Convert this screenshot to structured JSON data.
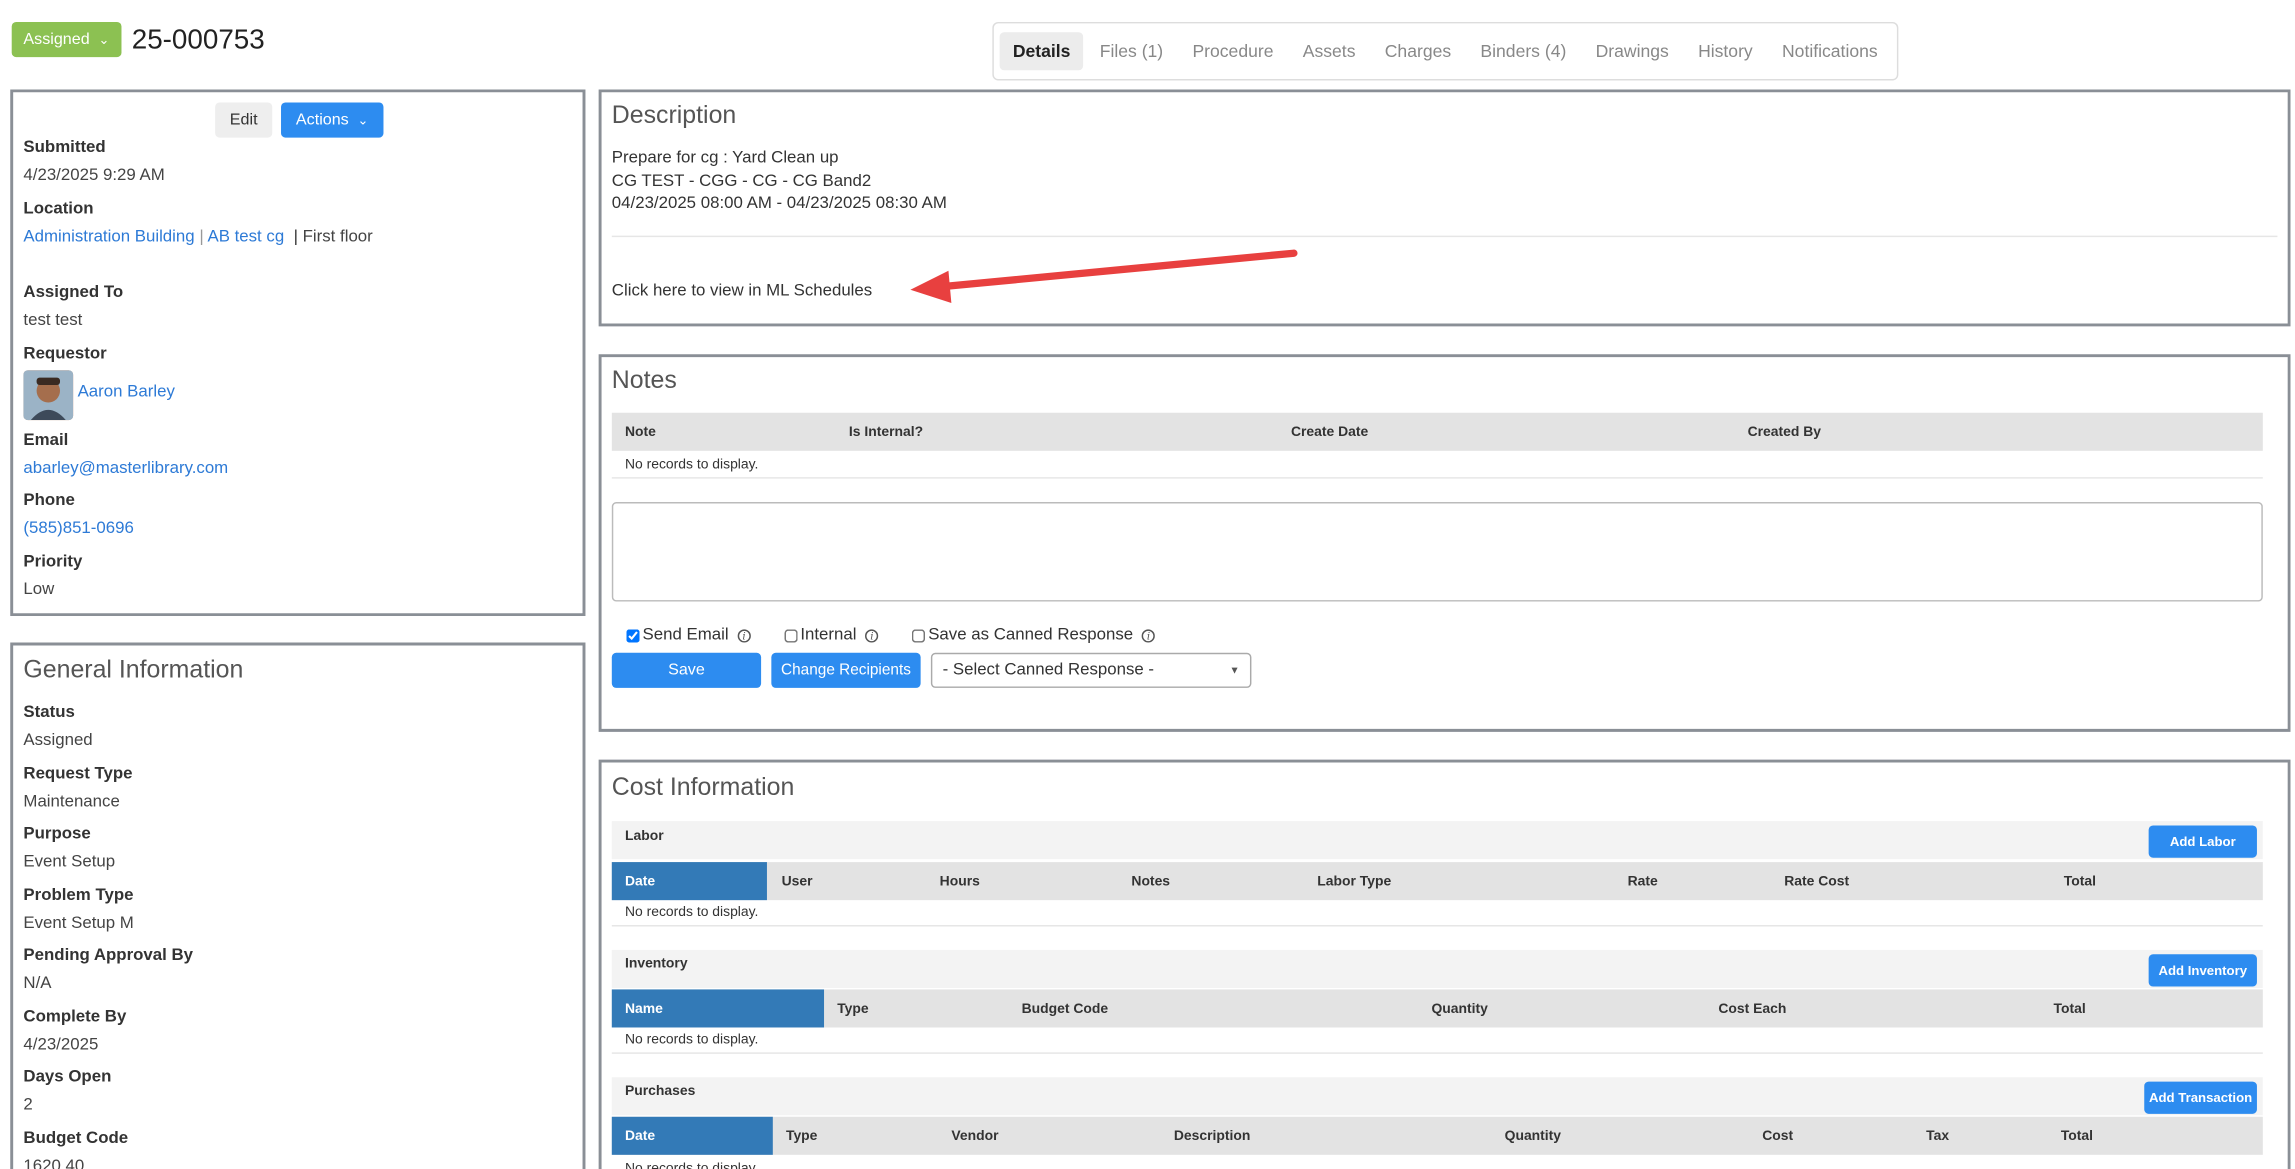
{
  "header": {
    "status": "Assigned",
    "number": "25-000753"
  },
  "tabs": [
    {
      "label": "Details"
    },
    {
      "label": "Files (1)"
    },
    {
      "label": "Procedure"
    },
    {
      "label": "Assets"
    },
    {
      "label": "Charges"
    },
    {
      "label": "Binders (4)"
    },
    {
      "label": "Drawings"
    },
    {
      "label": "History"
    },
    {
      "label": "Notifications"
    }
  ],
  "summary": {
    "edit": "Edit",
    "actions": "Actions",
    "submitted_label": "Submitted",
    "submitted": "4/23/2025 9:29 AM",
    "location_label": "Location",
    "loc_building": "Administration Building",
    "loc_room": "AB test cg",
    "loc_floor": "First floor",
    "assigned_label": "Assigned To",
    "assigned": "test test",
    "requestor_label": "Requestor",
    "requestor": "Aaron Barley",
    "email_label": "Email",
    "email": "abarley@masterlibrary.com",
    "phone_label": "Phone",
    "phone": "(585)851-0696",
    "priority_label": "Priority",
    "priority": "Low"
  },
  "general": {
    "title": "General Information",
    "fields": [
      {
        "label": "Status",
        "value": "Assigned"
      },
      {
        "label": "Request Type",
        "value": "Maintenance"
      },
      {
        "label": "Purpose",
        "value": "Event Setup"
      },
      {
        "label": "Problem Type",
        "value": "Event Setup M"
      },
      {
        "label": "Pending Approval By",
        "value": "N/A"
      },
      {
        "label": "Complete By",
        "value": "4/23/2025"
      },
      {
        "label": "Days Open",
        "value": "2"
      },
      {
        "label": "Budget Code",
        "value": "1620.40"
      }
    ]
  },
  "description": {
    "title": "Description",
    "lines": [
      "Prepare for cg : Yard Clean up",
      "CG TEST - CGG - CG - CG Band2",
      "04/23/2025 08:00 AM - 04/23/2025 08:30 AM"
    ],
    "link": "Click here to view in ML Schedules"
  },
  "notes": {
    "title": "Notes",
    "columns": [
      "Note",
      "Is Internal?",
      "Create Date",
      "Created By"
    ],
    "empty": "No records to display.",
    "send_email": "Send Email",
    "internal": "Internal",
    "canned": "Save as Canned Response",
    "save": "Save",
    "change_recipients": "Change Recipients",
    "select_placeholder": "- Select Canned Response -"
  },
  "cost": {
    "title": "Cost Information",
    "labor": {
      "title": "Labor",
      "button": "Add Labor",
      "columns": [
        "Date",
        "User",
        "Hours",
        "Notes",
        "Labor Type",
        "Rate",
        "Rate Cost",
        "Total"
      ]
    },
    "inventory": {
      "title": "Inventory",
      "button": "Add Inventory",
      "columns": [
        "Name",
        "Type",
        "Budget Code",
        "Quantity",
        "Cost Each",
        "Total"
      ]
    },
    "purchases": {
      "title": "Purchases",
      "button": "Add Transaction",
      "columns": [
        "Date",
        "Type",
        "Vendor",
        "Description",
        "Quantity",
        "Cost",
        "Tax",
        "Total"
      ]
    },
    "empty": "No records to display."
  },
  "colors": {
    "status": "#8cc152",
    "primary": "#2d8cf0",
    "header_sel": "#337ab7",
    "annotation": "#e8403f"
  }
}
